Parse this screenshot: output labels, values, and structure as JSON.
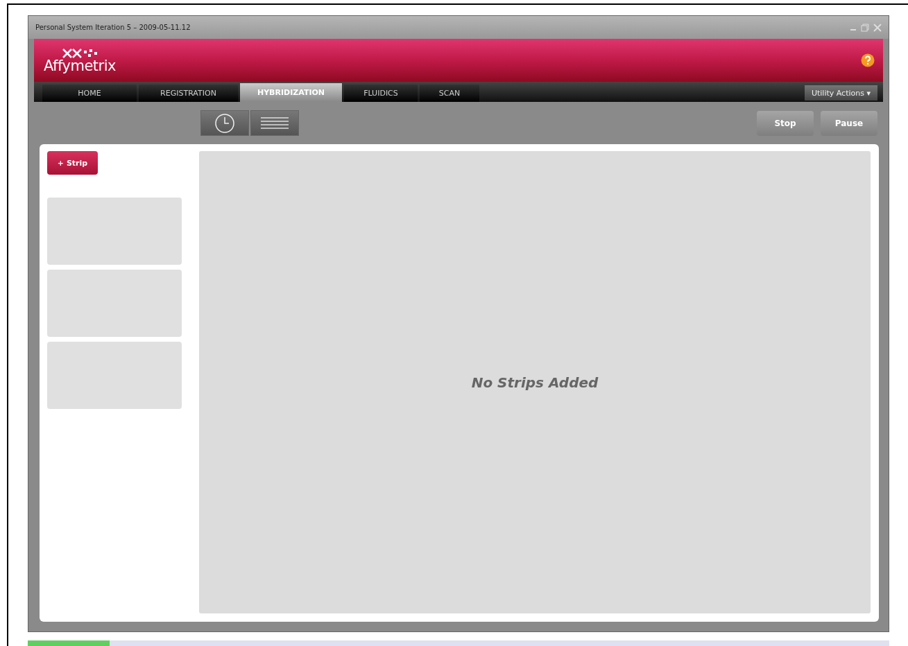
{
  "window": {
    "title": "Personal System Iteration 5 – 2009-05-11.12"
  },
  "header": {
    "logo": "Affymetrix"
  },
  "tabs": [
    {
      "label": "HOME",
      "selected": false
    },
    {
      "label": "REGISTRATION",
      "selected": false
    },
    {
      "label": "HYBRIDIZATION",
      "selected": true
    },
    {
      "label": "FLUIDICS",
      "selected": false
    },
    {
      "label": "SCAN",
      "selected": false
    }
  ],
  "utility_menu": {
    "label": "Utility Actions ▾"
  },
  "toolbar": {
    "buttons": [
      "Stop",
      "Pause"
    ]
  },
  "sidebar": {
    "add_button": "+ Strip"
  },
  "main": {
    "empty_message": "No Strips Added"
  }
}
